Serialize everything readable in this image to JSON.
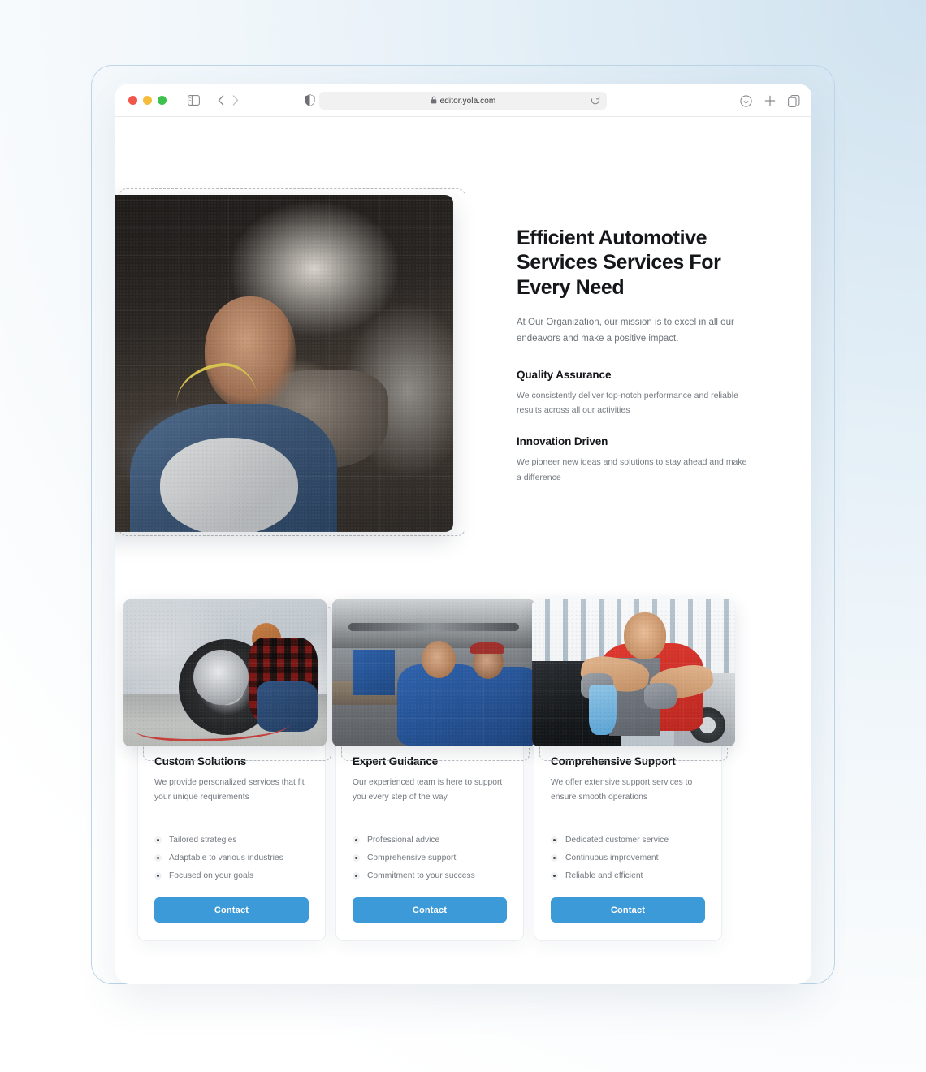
{
  "browser": {
    "url": "editor.yola.com",
    "icons": {
      "traffic_red": "close-window-dot",
      "traffic_yellow": "minimize-window-dot",
      "traffic_green": "maximize-window-dot",
      "sidebar": "sidebar-toggle-icon",
      "back": "chevron-left-icon",
      "forward": "chevron-right-icon",
      "shield": "privacy-shield-icon",
      "lock": "lock-icon",
      "reload": "reload-icon",
      "download": "download-icon",
      "new_tab": "plus-icon",
      "tabs": "tab-overview-icon"
    },
    "colors": {
      "traffic_red": "#f2564a",
      "traffic_yellow": "#f6bd3d",
      "traffic_green": "#3ec14e"
    }
  },
  "hero": {
    "heading": "Efficient Automotive Services Services For Every Need",
    "subtext": "At Our Organization, our mission is to excel in all our endeavors and make a positive impact.",
    "features": [
      {
        "title": "Quality Assurance",
        "text": "We consistently deliver top-notch performance and reliable results across all our activities"
      },
      {
        "title": "Innovation Driven",
        "text": "We pioneer new ideas and solutions to stay ahead and make a difference"
      }
    ],
    "image_alt": "mechanic-working-under-vehicle"
  },
  "cards": [
    {
      "title": "Custom Solutions",
      "description": "We provide personalized services that fit your unique requirements",
      "items": [
        "Tailored strategies",
        "Adaptable to various industries",
        "Focused on your goals"
      ],
      "button": "Contact",
      "image_alt": "mechanic-changing-car-tire"
    },
    {
      "title": "Expert Guidance",
      "description": "Our experienced team is here to support you every step of the way",
      "items": [
        "Professional advice",
        "Comprehensive support",
        "Commitment to your success"
      ],
      "button": "Contact",
      "image_alt": "two-mechanics-under-lifted-car"
    },
    {
      "title": "Comprehensive Support",
      "description": "We offer extensive support services to ensure smooth operations",
      "items": [
        "Dedicated customer service",
        "Continuous improvement",
        "Reliable and efficient"
      ],
      "button": "Contact",
      "image_alt": "smiling-mechanic-polishing-car"
    }
  ],
  "theme": {
    "accent": "#3d9ad9",
    "heading_color": "#14161a",
    "body_color": "#74797f",
    "selection_border": "#b9bdc2",
    "page_background": "#ffffff"
  }
}
